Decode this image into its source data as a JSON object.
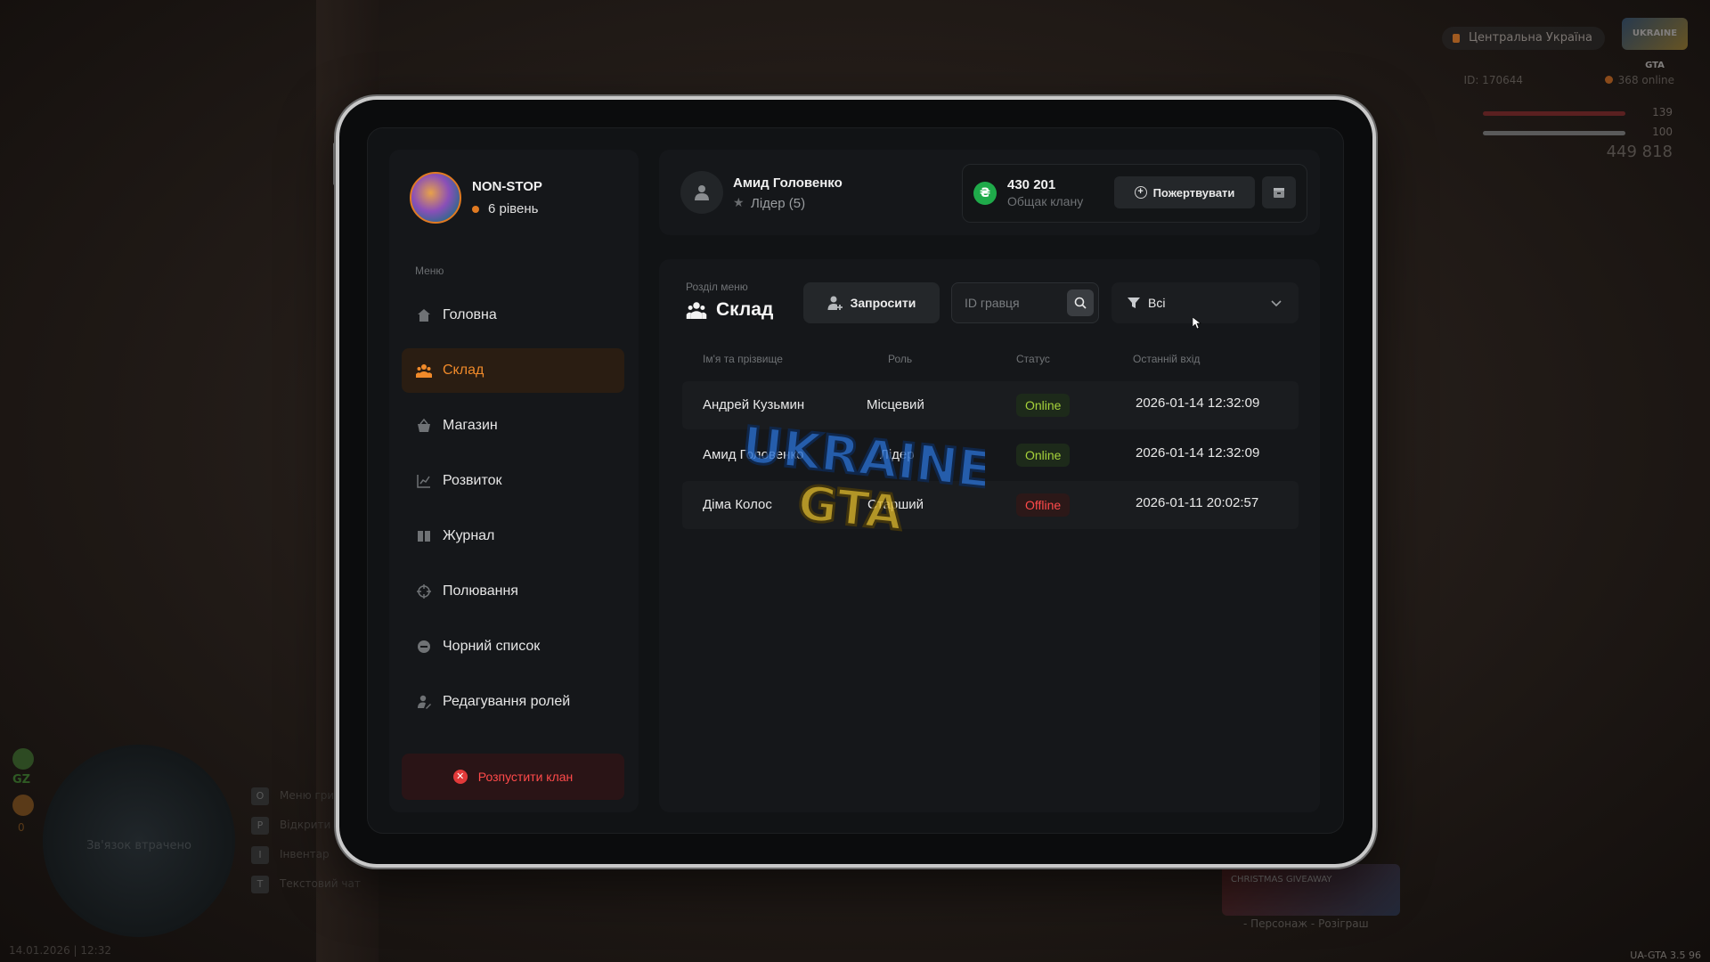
{
  "hud": {
    "region": "Центральна Україна",
    "logo_text": "UKRAINE GTA",
    "player_id": "ID: 170644",
    "online": "368 online",
    "health": "139",
    "armor": "100",
    "money": "449 818",
    "minimap_status": "Зв'язок втрачено",
    "gz_label": "GZ",
    "gz2_value": "0",
    "hints": [
      {
        "key": "O",
        "label": "Меню гри"
      },
      {
        "key": "P",
        "label": "Відкрити т"
      },
      {
        "key": "I",
        "label": "Інвентар"
      },
      {
        "key": "T",
        "label": "Текстовий чат"
      }
    ],
    "datetime": "14.01.2026 | 12:32",
    "giveaway_title": "CHRISTMAS GIVEAWAY",
    "giveaway_caption": "- Персонаж - Розіграш",
    "version": "UA-GTA 3.5",
    "fps": "96"
  },
  "clan": {
    "name": "NON-STOP",
    "level": "6 рівень"
  },
  "menu": {
    "caption": "Меню",
    "items": [
      {
        "label": "Головна",
        "icon": "home-icon"
      },
      {
        "label": "Склад",
        "icon": "people-icon",
        "active": true
      },
      {
        "label": "Магазин",
        "icon": "basket-icon"
      },
      {
        "label": "Розвиток",
        "icon": "chart-icon"
      },
      {
        "label": "Журнал",
        "icon": "book-icon"
      },
      {
        "label": "Полювання",
        "icon": "crosshair-icon"
      },
      {
        "label": "Чорний список",
        "icon": "block-icon"
      },
      {
        "label": "Редагування ролей",
        "icon": "user-edit-icon"
      }
    ],
    "disband_label": "Розпустити клан"
  },
  "user": {
    "name": "Амид Головенко",
    "role": "Лідер (5)"
  },
  "bank": {
    "currency_symbol": "₴",
    "amount": "430 201",
    "label": "Общак клану",
    "donate_label": "Пожертвувати"
  },
  "section": {
    "caption": "Розділ меню",
    "title": "Склад",
    "invite_label": "Запросити",
    "search_placeholder": "ID гравця",
    "filter_value": "Всі"
  },
  "table": {
    "headers": [
      "Ім'я та прізвище",
      "Роль",
      "Статус",
      "Останній вхід"
    ],
    "rows": [
      {
        "name": "Андрей Кузьмин",
        "role": "Місцевий",
        "status": "Online",
        "last": "2026-01-14 12:32:09"
      },
      {
        "name": "Амид Головенко",
        "role": "Лідер",
        "status": "Online",
        "last": "2026-01-14 12:32:09"
      },
      {
        "name": "Діма Колос",
        "role": "Старший",
        "status": "Offline",
        "last": "2026-01-11 20:02:57"
      }
    ]
  },
  "watermark": {
    "line1": "UKRAINE",
    "line2": "GTA"
  },
  "colors": {
    "accent": "#f08a2a",
    "online": "#a6d23a",
    "offline": "#ff4a4a",
    "coin": "#1faa4a"
  }
}
